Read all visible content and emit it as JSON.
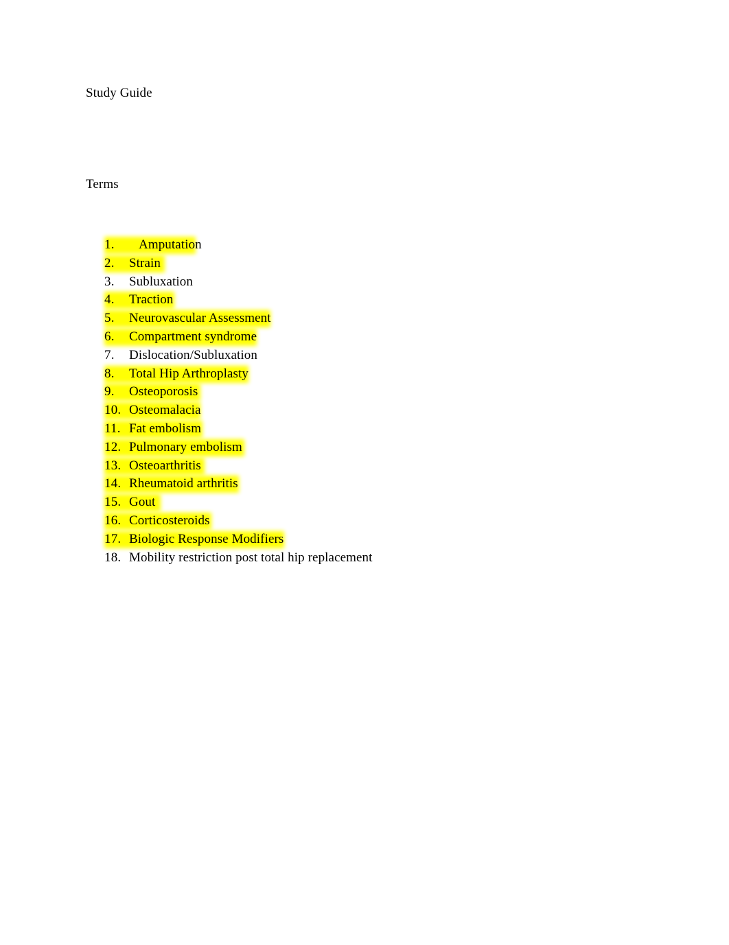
{
  "document": {
    "title": "Study Guide",
    "section_heading": "Terms",
    "page_background": "#ffffff",
    "text_color": "#000000",
    "highlight_color": "#ffff00"
  },
  "terms": [
    {
      "number": "1.",
      "label": "Amputation",
      "highlighted": true,
      "extra_indent": true,
      "hl_width": 133
    },
    {
      "number": "2.",
      "label": "Strain",
      "highlighted": true,
      "extra_indent": false,
      "hl_width": 88
    },
    {
      "number": "3.",
      "label": "Subluxation",
      "highlighted": false,
      "extra_indent": false,
      "hl_width": 0
    },
    {
      "number": "4.",
      "label": "Traction",
      "highlighted": true,
      "extra_indent": false,
      "hl_width": 102
    },
    {
      "number": "5.",
      "label": "Neurovascular Assessment",
      "highlighted": true,
      "extra_indent": false,
      "hl_width": 242
    },
    {
      "number": "6.",
      "label": "Compartment syndrome",
      "highlighted": true,
      "extra_indent": false,
      "hl_width": 222
    },
    {
      "number": "7.",
      "label": "Dislocation/Subluxation",
      "highlighted": false,
      "extra_indent": false,
      "hl_width": 0
    },
    {
      "number": "8.",
      "label": "Total Hip Arthroplasty",
      "highlighted": true,
      "extra_indent": false,
      "hl_width": 210
    },
    {
      "number": "9.",
      "label": "Osteoporosis",
      "highlighted": true,
      "extra_indent": false,
      "hl_width": 140
    },
    {
      "number": "10.",
      "label": "Osteomalacia",
      "highlighted": true,
      "extra_indent": false,
      "hl_width": 140
    },
    {
      "number": "11.",
      "label": "Fat embolism",
      "highlighted": true,
      "extra_indent": false,
      "hl_width": 143
    },
    {
      "number": "12.",
      "label": "Pulmonary embolism",
      "highlighted": true,
      "extra_indent": false,
      "hl_width": 204
    },
    {
      "number": "13.",
      "label": "Osteoarthritis",
      "highlighted": true,
      "extra_indent": false,
      "hl_width": 146
    },
    {
      "number": "14.",
      "label": "Rheumatoid arthritis",
      "highlighted": true,
      "extra_indent": false,
      "hl_width": 196
    },
    {
      "number": "15.",
      "label": "Gout",
      "highlighted": true,
      "extra_indent": false,
      "hl_width": 82
    },
    {
      "number": "16.",
      "label": "Corticosteroids",
      "highlighted": true,
      "extra_indent": false,
      "hl_width": 156
    },
    {
      "number": "17.",
      "label": "Biologic Response Modifiers",
      "highlighted": true,
      "extra_indent": false,
      "hl_width": 262
    },
    {
      "number": "18.",
      "label": "Mobility restriction post total hip replacement",
      "highlighted": false,
      "extra_indent": false,
      "hl_width": 0
    }
  ]
}
